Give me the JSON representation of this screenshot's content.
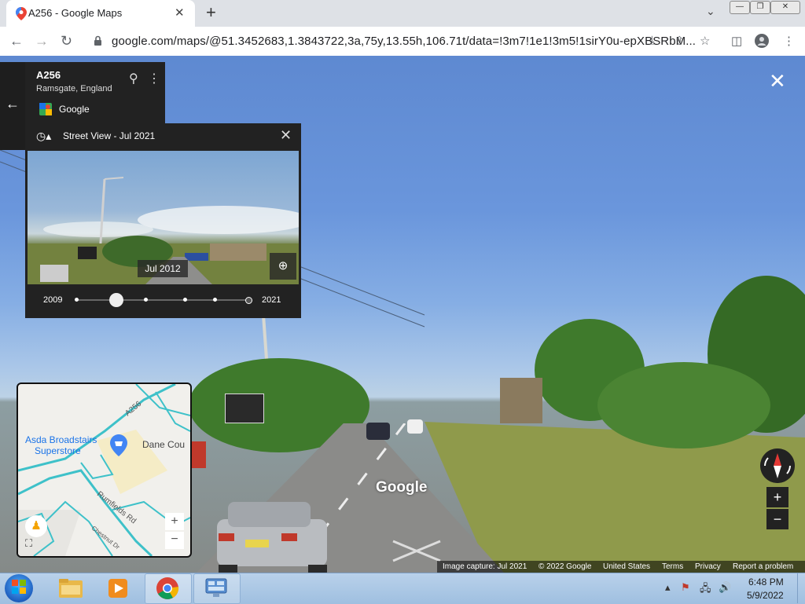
{
  "browser": {
    "tab_title": "A256 - Google Maps",
    "new_tab": "+",
    "close_tab": "✕",
    "url": "google.com/maps/@51.3452683,1.3843722,3a,75y,13.55h,106.71t/data=!3m7!1e1!3m5!1sirY0u-epXBSRbM..."
  },
  "place": {
    "title": "A256",
    "subtitle": "Ramsgate, England",
    "source": "Google"
  },
  "time_machine": {
    "header": "Street View - Jul 2021",
    "preview_date": "Jul 2012",
    "start_year": "2009",
    "end_year": "2021",
    "selected_index": 1,
    "stops": 6
  },
  "minimap": {
    "poi_line1": "Asda Broadstairs",
    "poi_line2": "Superstore",
    "place_label": "Dane Cou",
    "road_a256": "A256",
    "road_rumfields": "Rumfields Rd",
    "road_chestnut": "Chestnut Dr"
  },
  "scene": {
    "watermark": "Google"
  },
  "footer": {
    "capture": "Image capture: Jul 2021",
    "copyright": "© 2022 Google",
    "region": "United States",
    "terms": "Terms",
    "privacy": "Privacy",
    "report": "Report a problem"
  },
  "taskbar": {
    "time": "6:48 PM",
    "date": "5/9/2022"
  }
}
